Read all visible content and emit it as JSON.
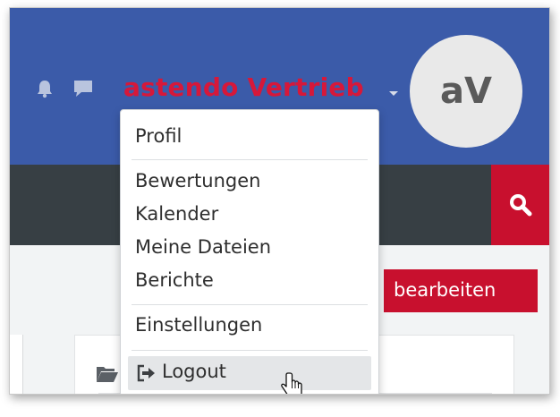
{
  "header": {
    "user_name": "astendo Vertrieb",
    "avatar_initials": "aV",
    "bell_icon": "bell-icon",
    "chat_icon": "chat-icon"
  },
  "search": {
    "icon": "search-icon"
  },
  "content": {
    "edit_button_label": "bearbeiten",
    "folder_icon": "folder-open-icon"
  },
  "dropdown": {
    "items": [
      {
        "label": "Profil"
      },
      {
        "label": "Bewertungen"
      },
      {
        "label": "Kalender"
      },
      {
        "label": "Meine Dateien"
      },
      {
        "label": "Berichte"
      },
      {
        "label": "Einstellungen"
      },
      {
        "label": "Logout",
        "icon": "sign-out-icon"
      }
    ]
  },
  "colors": {
    "header_bg": "#3b5ba9",
    "searchbar_bg": "#373f44",
    "accent_red": "#c8102e",
    "username_red": "#d6183a"
  }
}
